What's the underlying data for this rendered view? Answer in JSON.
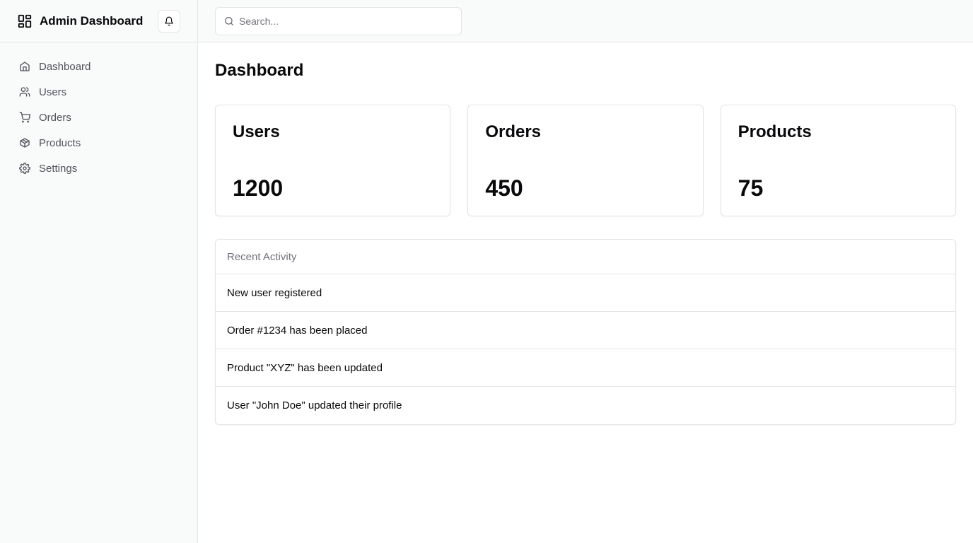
{
  "app": {
    "title": "Admin Dashboard",
    "brand_icon": "dashboard-grid-icon",
    "notification_icon": "bell-icon"
  },
  "sidebar": {
    "items": [
      {
        "label": "Dashboard",
        "icon": "home-icon"
      },
      {
        "label": "Users",
        "icon": "users-icon"
      },
      {
        "label": "Orders",
        "icon": "cart-icon"
      },
      {
        "label": "Products",
        "icon": "package-icon"
      },
      {
        "label": "Settings",
        "icon": "gear-icon"
      }
    ]
  },
  "search": {
    "placeholder": "Search...",
    "value": "",
    "icon": "search-icon"
  },
  "main": {
    "page_title": "Dashboard",
    "stats": [
      {
        "title": "Users",
        "value": "1200"
      },
      {
        "title": "Orders",
        "value": "450"
      },
      {
        "title": "Products",
        "value": "75"
      }
    ],
    "activity": {
      "header": "Recent Activity",
      "items": [
        "New user registered",
        "Order #1234 has been placed",
        "Product \"XYZ\" has been updated",
        "User \"John Doe\" updated their profile"
      ]
    }
  },
  "colors": {
    "sidebar_bg": "#f9fafa",
    "border": "#e4e4e7",
    "text_primary": "#09090b",
    "text_muted": "#71717a",
    "nav_text": "#52525b"
  }
}
